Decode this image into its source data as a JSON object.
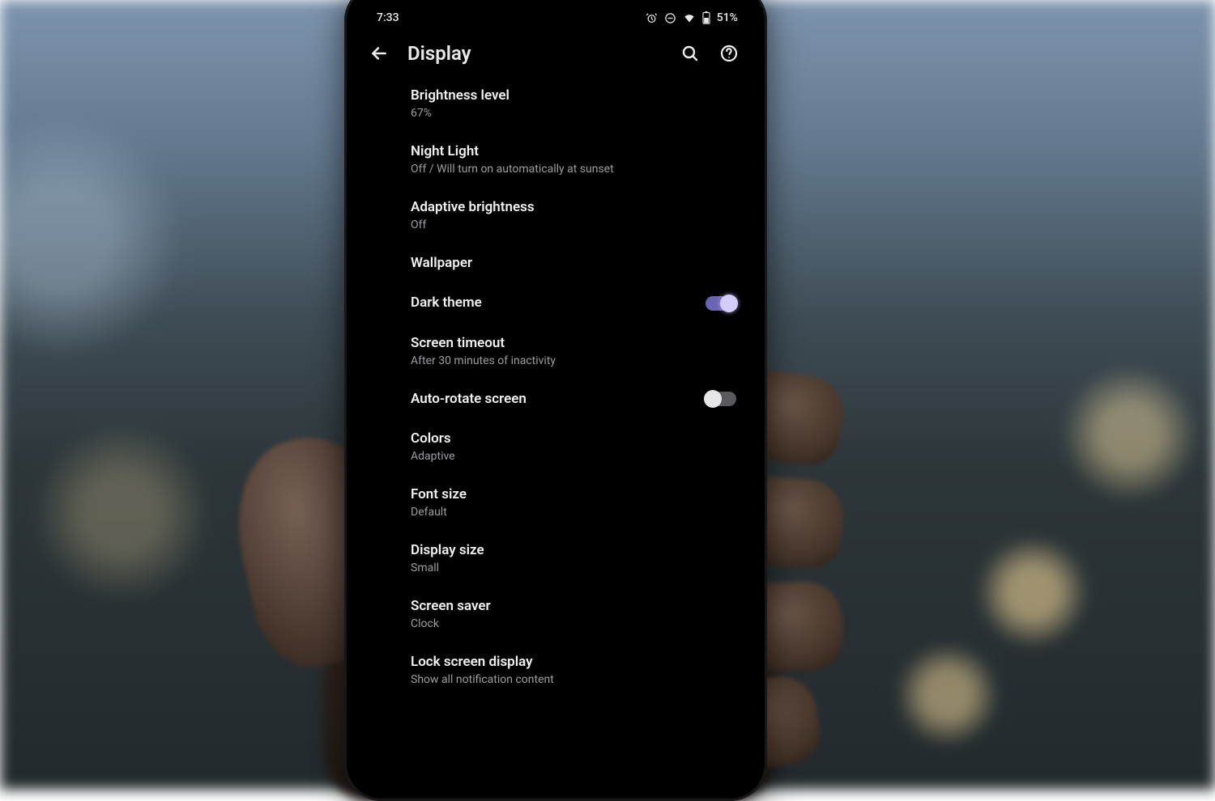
{
  "status": {
    "time": "7:33",
    "battery": "51%"
  },
  "header": {
    "title": "Display"
  },
  "settings": {
    "brightness_level": {
      "title": "Brightness level",
      "sub": "67%"
    },
    "night_light": {
      "title": "Night Light",
      "sub": "Off / Will turn on automatically at sunset"
    },
    "adaptive_brightness": {
      "title": "Adaptive brightness",
      "sub": "Off"
    },
    "wallpaper": {
      "title": "Wallpaper"
    },
    "dark_theme": {
      "title": "Dark theme",
      "state": "on"
    },
    "screen_timeout": {
      "title": "Screen timeout",
      "sub": "After 30 minutes of inactivity"
    },
    "auto_rotate": {
      "title": "Auto-rotate screen",
      "state": "off"
    },
    "colors": {
      "title": "Colors",
      "sub": "Adaptive"
    },
    "font_size": {
      "title": "Font size",
      "sub": "Default"
    },
    "display_size": {
      "title": "Display size",
      "sub": "Small"
    },
    "screen_saver": {
      "title": "Screen saver",
      "sub": "Clock"
    },
    "lock_screen": {
      "title": "Lock screen display",
      "sub": "Show all notification content"
    }
  }
}
